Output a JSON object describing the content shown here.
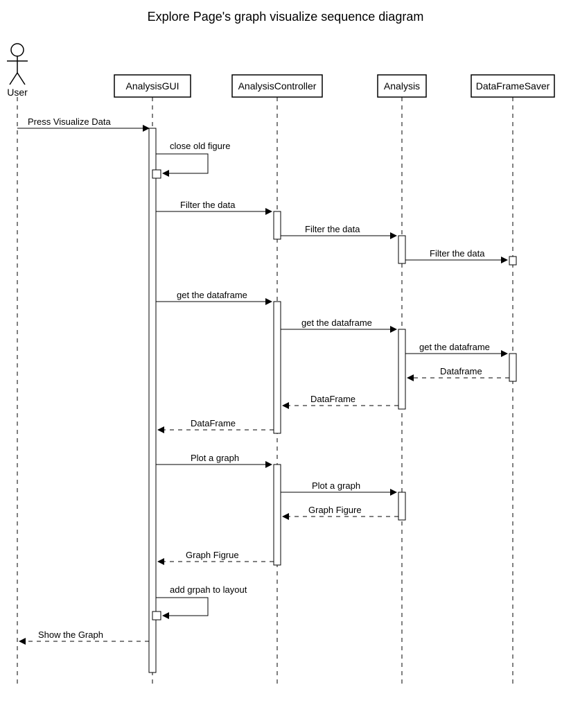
{
  "title": "Explore Page's graph visualize sequence diagram",
  "participants": {
    "user": "User",
    "p1": "AnalysisGUI",
    "p2": "AnalysisController",
    "p3": "Analysis",
    "p4": "DataFrameSaver"
  },
  "messages": {
    "m1": "Press Visualize Data",
    "m2": "close old figure",
    "m3": "Filter the data",
    "m4": "Filter the data",
    "m5": "Filter the data",
    "m6": "get the dataframe",
    "m7": "get the dataframe",
    "m8": "get the dataframe",
    "m9": "Dataframe",
    "m10": "DataFrame",
    "m11": "DataFrame",
    "m12": "Plot a graph",
    "m13": "Plot a graph",
    "m14": "Graph Figure",
    "m15": "Graph Figrue",
    "m16": "add grpah to layout",
    "m17": "Show the Graph"
  }
}
